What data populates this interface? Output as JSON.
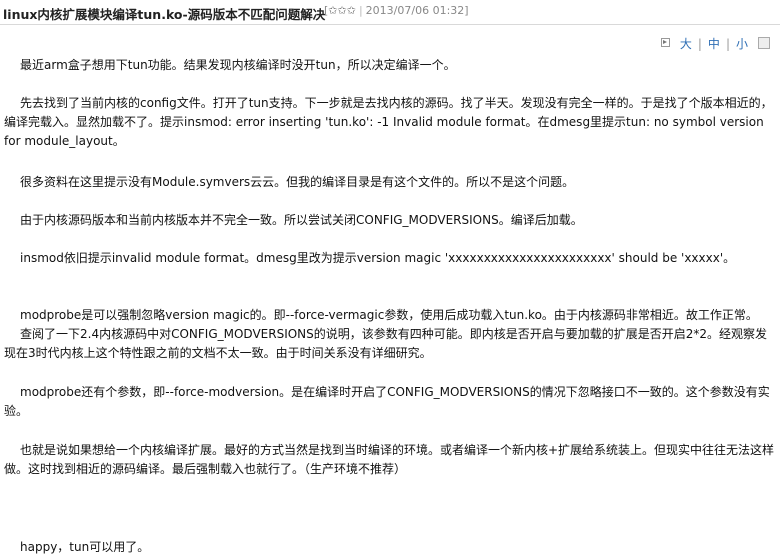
{
  "header": {
    "title": "linux内核扩展模块编译tun.ko-源码版本不匹配问题解决",
    "bracket_open": "[",
    "stars": [
      "✩",
      "✩",
      "✩"
    ],
    "separator": "|",
    "date": "2013/07/06 01:32",
    "bracket_close": "]"
  },
  "fontbar": {
    "large": "大",
    "medium": "中",
    "small": "小",
    "sep": "|"
  },
  "article": {
    "paragraphs": [
      "最近arm盒子想用下tun功能。结果发现内核编译时没开tun，所以决定编译一个。",
      "先去找到了当前内核的config文件。打开了tun支持。下一步就是去找内核的源码。找了半天。发现没有完全一样的。于是找了个版本相近的，编译完载入。显然加载不了。提示insmod: error inserting 'tun.ko': -1 Invalid module format。在dmesg里提示tun: no symbol version for module_layout。",
      "很多资料在这里提示没有Module.symvers云云。但我的编译目录是有这个文件的。所以不是这个问题。",
      "由于内核源码版本和当前内核版本并不完全一致。所以尝试关闭CONFIG_MODVERSIONS。编译后加载。",
      "insmod依旧提示invalid module format。dmesg里改为提示version magic 'xxxxxxxxxxxxxxxxxxxxxxx' should be 'xxxxx'。",
      "modprobe是可以强制忽略version magic的。即--force-vermagic参数，使用后成功载入tun.ko。由于内核源码非常相近。故工作正常。",
      "查阅了一下2.4内核源码中对CONFIG_MODVERSIONS的说明，该参数有四种可能。即内核是否开启与要加载的扩展是否开启2*2。经观察发现在3时代内核上这个特性跟之前的文档不太一致。由于时间关系没有详细研究。",
      "modprobe还有个参数，即--force-modversion。是在编译时开启了CONFIG_MODVERSIONS的情况下忽略接口不一致的。这个参数没有实验。",
      "也就是说如果想给一个内核编译扩展。最好的方式当然是找到当时编译的环境。或者编译一个新内核+扩展给系统装上。但现实中往往无法这样做。这时找到相近的源码编译。最后强制载入也就行了。（生产环境不推荐）",
      "happy，tun可以用了。"
    ]
  }
}
